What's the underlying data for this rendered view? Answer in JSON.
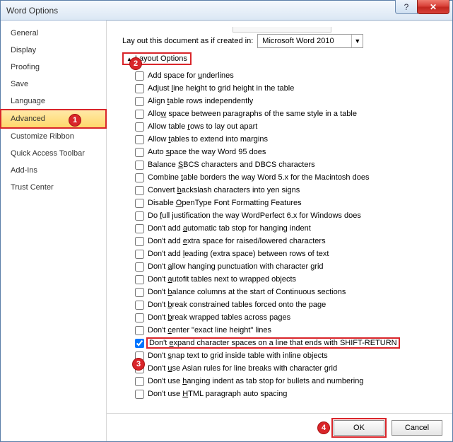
{
  "window": {
    "title": "Word Options"
  },
  "sidebar": {
    "items": [
      {
        "label": "General"
      },
      {
        "label": "Display"
      },
      {
        "label": "Proofing"
      },
      {
        "label": "Save"
      },
      {
        "label": "Language"
      },
      {
        "label": "Advanced",
        "selected": true
      },
      {
        "label": "Customize Ribbon"
      },
      {
        "label": "Quick Access Toolbar"
      },
      {
        "label": "Add-Ins"
      },
      {
        "label": "Trust Center"
      }
    ]
  },
  "layout": {
    "compat_label": "Lay out this document as if created in:",
    "compat_value": "Microsoft Word 2010",
    "section_title": "Layout Options",
    "options": [
      {
        "pre": "Add space for ",
        "u": "u",
        "post": "nderlines",
        "checked": false
      },
      {
        "pre": "Adjust ",
        "u": "l",
        "post": "ine height to grid height in the table",
        "checked": false
      },
      {
        "pre": "Align ",
        "u": "t",
        "post": "able rows independently",
        "checked": false
      },
      {
        "pre": "Allo",
        "u": "w",
        "post": " space between paragraphs of the same style in a table",
        "checked": false
      },
      {
        "pre": "Allow table ",
        "u": "r",
        "post": "ows to lay out apart",
        "checked": false
      },
      {
        "pre": "Allow ",
        "u": "t",
        "post": "ables to extend into margins",
        "checked": false
      },
      {
        "pre": "Auto ",
        "u": "s",
        "post": "pace the way Word 95 does",
        "checked": false
      },
      {
        "pre": "Balance ",
        "u": "S",
        "post": "BCS characters and DBCS characters",
        "checked": false
      },
      {
        "pre": "Combine ",
        "u": "t",
        "post": "able borders the way Word 5.x for the Macintosh does",
        "checked": false
      },
      {
        "pre": "Convert ",
        "u": "b",
        "post": "ackslash characters into yen signs",
        "checked": false
      },
      {
        "pre": "Disable ",
        "u": "O",
        "post": "penType Font Formatting Features",
        "checked": false
      },
      {
        "pre": "Do ",
        "u": "f",
        "post": "ull justification the way WordPerfect 6.x for Windows does",
        "checked": false
      },
      {
        "pre": "Don't add ",
        "u": "a",
        "post": "utomatic tab stop for hanging indent",
        "checked": false
      },
      {
        "pre": "Don't add ",
        "u": "e",
        "post": "xtra space for raised/lowered characters",
        "checked": false
      },
      {
        "pre": "Don't add ",
        "u": "l",
        "post": "eading (extra space) between rows of text",
        "checked": false
      },
      {
        "pre": "Don't ",
        "u": "a",
        "post": "llow hanging punctuation with character grid",
        "checked": false
      },
      {
        "pre": "Don't ",
        "u": "a",
        "post": "utofit tables next to wrapped objects",
        "checked": false
      },
      {
        "pre": "Don't ",
        "u": "b",
        "post": "alance columns at the start of Continuous sections",
        "checked": false
      },
      {
        "pre": "Don't ",
        "u": "b",
        "post": "reak constrained tables forced onto the page",
        "checked": false
      },
      {
        "pre": "Don't ",
        "u": "b",
        "post": "reak wrapped tables across pages",
        "checked": false
      },
      {
        "pre": "Don't ",
        "u": "c",
        "post": "enter \"exact line height\" lines",
        "checked": false
      },
      {
        "pre": "Don't ",
        "u": "e",
        "post": "xpand character spaces on a line that ends with SHIFT-RETURN",
        "checked": true,
        "highlight": true
      },
      {
        "pre": "Don't ",
        "u": "s",
        "post": "nap text to grid inside table with inline objects",
        "checked": false
      },
      {
        "pre": "Don't ",
        "u": "u",
        "post": "se Asian rules for line breaks with character grid",
        "checked": false
      },
      {
        "pre": "Don't use ",
        "u": "h",
        "post": "anging indent as tab stop for bullets and numbering",
        "checked": false
      },
      {
        "pre": "Don't use ",
        "u": "H",
        "post": "TML paragraph auto spacing",
        "checked": false
      }
    ]
  },
  "footer": {
    "ok": "OK",
    "cancel": "Cancel"
  },
  "bubbles": {
    "b1": "1",
    "b2": "2",
    "b3": "3",
    "b4": "4"
  },
  "colors": {
    "accent_red": "#d9252a",
    "highlight_yellow": "#ffd86b"
  }
}
